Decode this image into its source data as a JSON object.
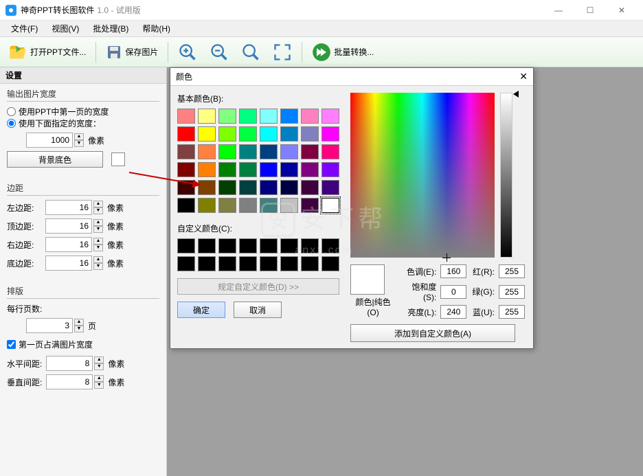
{
  "titlebar": {
    "app_name": "神奇PPT转长图软件",
    "version": "1.0 - 试用版"
  },
  "menubar": {
    "file": "文件(F)",
    "view": "视图(V)",
    "batch": "批处理(B)",
    "help": "帮助(H)"
  },
  "toolbar": {
    "open_ppt": "打开PPT文件...",
    "save_img": "保存图片",
    "batch_convert": "批量转换..."
  },
  "sidebar": {
    "settings": "设置",
    "output_width": {
      "title": "输出图片宽度",
      "opt1": "使用PPT中第一页的宽度",
      "opt2": "使用下面指定的宽度：",
      "value": "1000",
      "unit": "像素",
      "bg_btn": "背景底色"
    },
    "margin": {
      "title": "边距",
      "left": "左边距:",
      "top": "顶边距:",
      "right": "右边距:",
      "bottom": "底边距:",
      "val_left": "16",
      "val_top": "16",
      "val_right": "16",
      "val_bottom": "16",
      "unit": "像素"
    },
    "layout": {
      "title": "排版",
      "per_row": "每行页数:",
      "per_row_val": "3",
      "per_row_unit": "页",
      "first_full": "第一页占满图片宽度",
      "hgap": "水平间距:",
      "vgap": "垂直间距:",
      "hgap_val": "8",
      "vgap_val": "8",
      "unit": "像素"
    }
  },
  "color_dialog": {
    "title": "颜色",
    "basic_label": "基本颜色(B):",
    "custom_label": "自定义颜色(C):",
    "define_btn": "规定自定义颜色(D) >>",
    "ok": "确定",
    "cancel": "取消",
    "solid_label": "颜色|纯色(O)",
    "hue": "色调(E):",
    "sat": "饱和度(S):",
    "lum": "亮度(L):",
    "r": "红(R):",
    "g": "绿(G):",
    "b": "蓝(U):",
    "hue_v": "160",
    "sat_v": "0",
    "lum_v": "240",
    "r_v": "255",
    "g_v": "255",
    "b_v": "255",
    "add_custom": "添加到自定义颜色(A)",
    "basic_colors": [
      "#ff8080",
      "#ffff80",
      "#80ff80",
      "#00ff80",
      "#80ffff",
      "#0080ff",
      "#ff80c0",
      "#ff80ff",
      "#ff0000",
      "#ffff00",
      "#80ff00",
      "#00ff40",
      "#00ffff",
      "#0080c0",
      "#8080c0",
      "#ff00ff",
      "#804040",
      "#ff8040",
      "#00ff00",
      "#008080",
      "#004080",
      "#8080ff",
      "#800040",
      "#ff0080",
      "#800000",
      "#ff8000",
      "#008000",
      "#008040",
      "#0000ff",
      "#0000a0",
      "#800080",
      "#8000ff",
      "#400000",
      "#804000",
      "#004000",
      "#004040",
      "#000080",
      "#000040",
      "#400040",
      "#400080",
      "#000000",
      "#808000",
      "#808040",
      "#808080",
      "#408080",
      "#c0c0c0",
      "#400040",
      "#ffffff"
    ]
  }
}
